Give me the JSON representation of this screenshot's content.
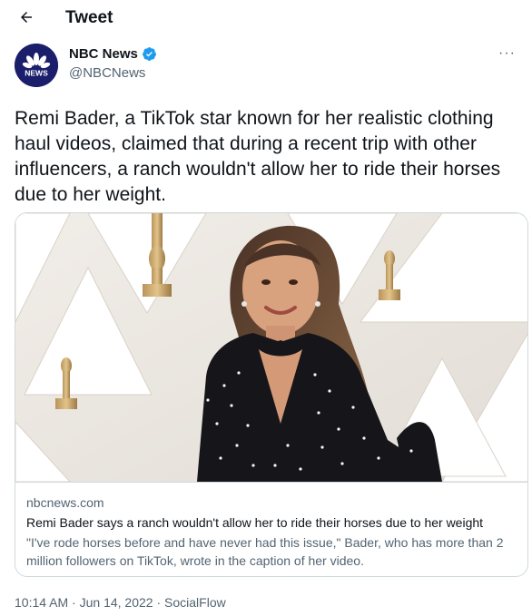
{
  "header": {
    "title": "Tweet",
    "back_icon": "arrow-left-icon"
  },
  "author": {
    "display_name": "NBC News",
    "handle": "@NBCNews",
    "avatar_text": "NEWS",
    "verified": true,
    "verified_color": "#1d9bf0"
  },
  "more_label": "···",
  "tweet": {
    "text": "Remi Bader, a TikTok star known for her realistic clothing haul videos, claimed that during a recent trip with other influencers, a ranch wouldn't allow her to ride their horses due to her weight."
  },
  "card": {
    "domain": "nbcnews.com",
    "title": "Remi Bader says a ranch wouldn't allow her to ride their horses due to her weight",
    "description": "\"I've rode horses before and have never had this issue,\" Bader, who has more than 2 million followers on TikTok, wrote in the caption of her video."
  },
  "meta": {
    "time": "10:14 AM",
    "separator1": " · ",
    "date": "Jun 14, 2022",
    "separator2": " · ",
    "source": "SocialFlow"
  }
}
